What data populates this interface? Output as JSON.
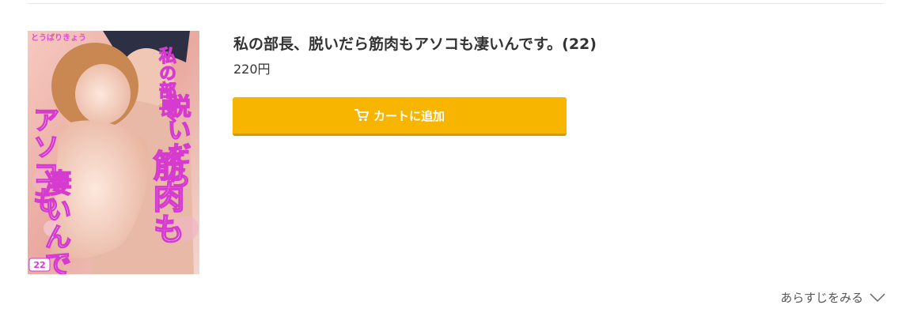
{
  "product": {
    "title": "私の部長、脱いだら筋肉もアソコも凄いんです。(22)",
    "price": "220円",
    "cover_icon": "book-cover-image",
    "cover_texts": {
      "author": "とうばりきょう",
      "title_line_1": "私の部長、",
      "title_line_2": "脱いだら",
      "title_line_3": "筋肉も",
      "title_line_4": "アソコも",
      "title_line_5": "凄いんです。",
      "volume": "22"
    }
  },
  "actions": {
    "cart_label": "カートに追加",
    "cart_icon": "cart-plus-icon",
    "synopsis_label": "あらすじをみる",
    "synopsis_icon": "chevron-down-icon"
  },
  "colors": {
    "cart_button": "#f7b500",
    "cart_button_shadow": "#d29900",
    "title_text": "#333333",
    "cover_title": "#d63bd0"
  }
}
